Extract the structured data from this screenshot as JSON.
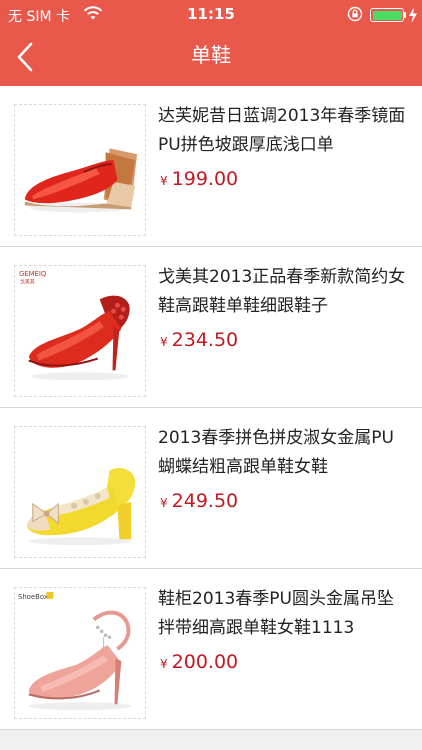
{
  "status_bar": {
    "carrier": "无 SIM 卡",
    "time": "11:15"
  },
  "nav": {
    "title": "单鞋"
  },
  "currency_symbol": "¥",
  "products": [
    {
      "name": "达芙妮昔日蓝调2013年春季镜面PU拼色坡跟厚底浅口单",
      "price": "199.00",
      "image": "red-wedge-shoe"
    },
    {
      "name": "戈美其2013正品春季新款简约女鞋高跟鞋单鞋细跟鞋子",
      "price": "234.50",
      "image": "red-heel-shoe",
      "brand_mark": "GEMEIQ",
      "brand_mark_cn": "戈美其"
    },
    {
      "name": "2013春季拼色拼皮淑女金属PU蝴蝶结粗高跟单鞋女鞋",
      "price": "249.50",
      "image": "yellow-bow-shoe"
    },
    {
      "name": "鞋柜2013春季PU圆头金属吊坠拌带细高跟单鞋女鞋1113",
      "price": "200.00",
      "image": "pink-strap-shoe",
      "brand_mark": "ShoeBox"
    }
  ],
  "colors": {
    "header": "#e8584b",
    "price": "#c01a22"
  }
}
